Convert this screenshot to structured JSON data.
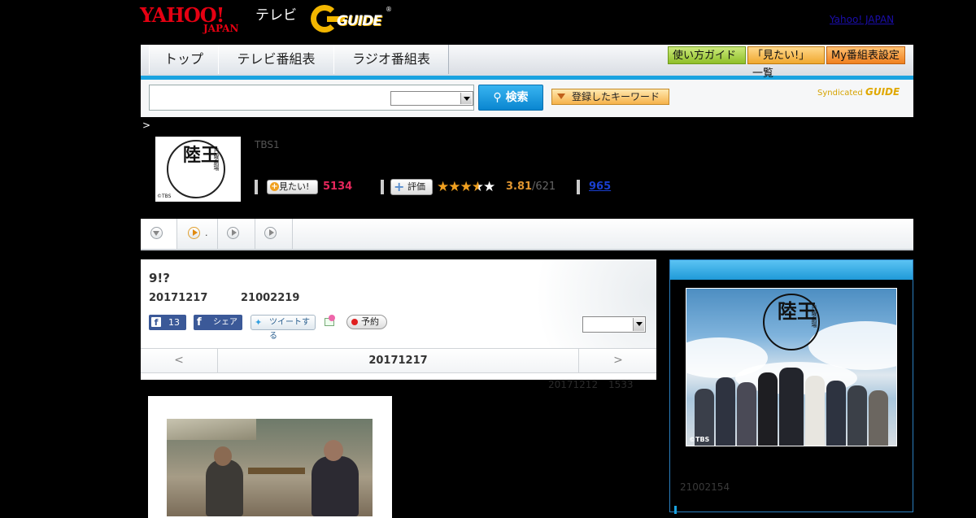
{
  "header": {
    "logo_yahoo_top": "YAHOO!",
    "logo_yahoo_sub": "JAPAN",
    "logo_tv": "テレビ",
    "logo_gguide": "GUIDE",
    "logo_reg": "®",
    "yahoo_link": "Yahoo! JAPAN"
  },
  "nav": {
    "tabs": [
      "トップ",
      "テレビ番組表",
      "ラジオ番組表"
    ],
    "buttons": [
      "使い方ガイド",
      "「見たい!」一覧",
      "My番組表設定"
    ]
  },
  "search": {
    "button_label": "検索",
    "keyword_button_label": "登録したキーワード",
    "syndicated_label": "Syndicated",
    "syndicated_logo": "GUIDE"
  },
  "breadcrumb_separator": ">",
  "program": {
    "logo_kanji": "陸王",
    "logo_sub": "日曜劇場",
    "logo_copyright": "©TBS",
    "channel": "TBS1",
    "mitai_label": "見たい!",
    "mitai_count": "5134",
    "hyoka_label": "評価",
    "stars": [
      "★",
      "★",
      "★",
      "★",
      "★"
    ],
    "rating": "3.81",
    "rating_count": "/621",
    "review_count": "965"
  },
  "episode_tabs": [
    {
      "icon": "chevron-down",
      "label": ""
    },
    {
      "icon": "play",
      "label": "."
    },
    {
      "icon": "play",
      "label": ""
    },
    {
      "icon": "play",
      "label": ""
    }
  ],
  "episode": {
    "title": "9!?",
    "date": "20171217",
    "time": "21002219",
    "fb_count": "13",
    "fb_share_label": "シェア",
    "tweet_label": "ツイートする",
    "reserve_label": "予約",
    "pager_prev": "<",
    "pager_date": "20171217",
    "pager_next": ">",
    "update_date": "20171212",
    "update_count": "1533"
  },
  "side": {
    "photo_kanji": "陸王",
    "photo_sub": "日曜劇場",
    "photo_copyright": "©TBS",
    "date": "21002154"
  },
  "colors": {
    "accent_blue": "#1aa3e0",
    "mitai_pink": "#e5265b",
    "rating_orange": "#e09530",
    "star_gold": "#f0a020"
  }
}
